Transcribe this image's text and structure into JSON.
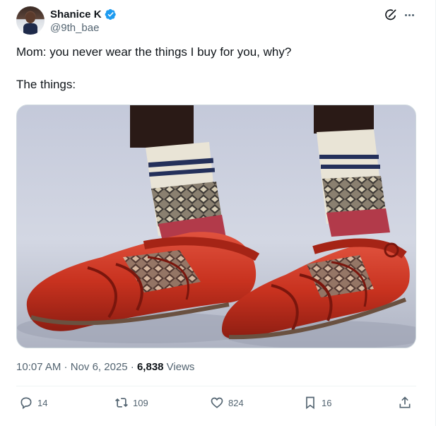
{
  "author": {
    "name": "Shanice K",
    "handle": "@9th_bae",
    "verified": true
  },
  "header_icons": [
    "grok-icon",
    "more-icon"
  ],
  "tweet": {
    "line1": "Mom: you never wear the things I buy for you, why?",
    "line2": "The things:"
  },
  "media": {
    "description_icon": "photo"
  },
  "meta": {
    "time": "10:07 AM",
    "separator1": " · ",
    "date": "Nov 6, 2025",
    "separator2": " · ",
    "views_count": "6,838",
    "views_label": " Views"
  },
  "actions": {
    "replies": "14",
    "reposts": "109",
    "likes": "824",
    "bookmarks": "16"
  },
  "colors": {
    "verified": "#1d9bf0",
    "secondary_text": "#536471",
    "primary_text": "#0f1419"
  }
}
